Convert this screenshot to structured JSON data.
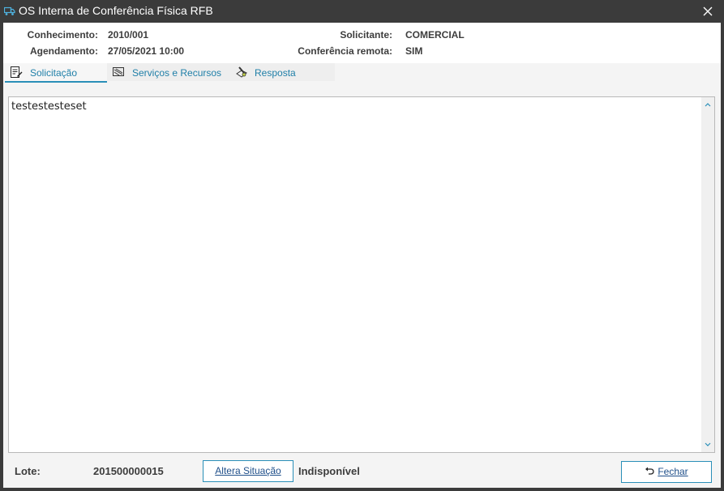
{
  "window": {
    "title": "OS Interna de Conferência Física RFB",
    "title_icon": "truck-icon",
    "close_icon": "close-icon"
  },
  "header": {
    "conhecimento_label": "Conhecimento:",
    "conhecimento_value": "2010/001",
    "agendamento_label": "Agendamento:",
    "agendamento_value": "27/05/2021 10:00",
    "solicitante_label": "Solicitante:",
    "solicitante_value": "COMERCIAL",
    "conferencia_label": "Conferência remota:",
    "conferencia_value": "SIM"
  },
  "tabs": [
    {
      "label": "Solicitação",
      "icon": "document-edit-icon",
      "active": true
    },
    {
      "label": "Serviços e Recursos",
      "icon": "list-icon",
      "active": false
    },
    {
      "label": "Resposta",
      "icon": "pen-paper-icon",
      "active": false
    }
  ],
  "content": {
    "text": "testestesteset"
  },
  "footer": {
    "lote_label": "Lote:",
    "lote_value": "201500000015",
    "altera_button": "Altera Situação",
    "status": "Indisponível",
    "fechar_button": "Fechar"
  },
  "colors": {
    "accent": "#2a8fb8",
    "titlebar": "#3b3b3b",
    "tab_text": "#1f7fa8"
  }
}
